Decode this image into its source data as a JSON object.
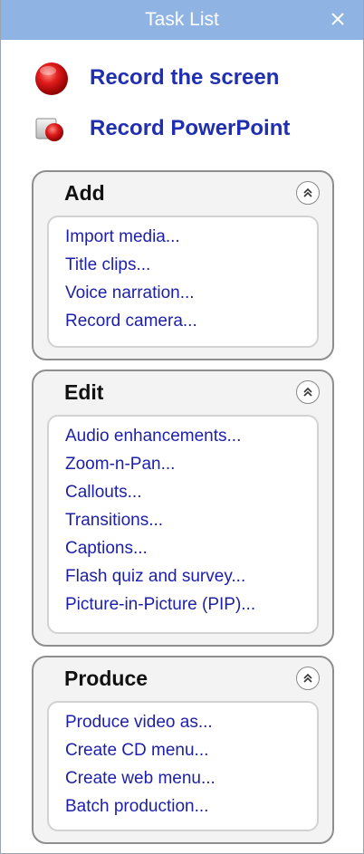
{
  "window": {
    "title": "Task List",
    "close_glyph": "✕"
  },
  "record": [
    {
      "label": "Record the screen",
      "icon": "record-screen-icon"
    },
    {
      "label": "Record PowerPoint",
      "icon": "record-powerpoint-icon"
    }
  ],
  "groups": {
    "add": {
      "title": "Add",
      "items": [
        "Import media...",
        "Title clips...",
        "Voice narration...",
        "Record camera..."
      ]
    },
    "edit": {
      "title": "Edit",
      "items": [
        "Audio enhancements...",
        "Zoom-n-Pan...",
        "Callouts...",
        "Transitions...",
        "Captions...",
        "Flash quiz and survey...",
        "Picture-in-Picture (PIP)..."
      ]
    },
    "produce": {
      "title": "Produce",
      "items": [
        "Produce video as...",
        "Create CD menu...",
        "Create web menu...",
        "Batch production..."
      ]
    }
  },
  "colors": {
    "titlebar": "#8fb4e3",
    "link": "#1c1fa8",
    "record_label": "#1f2fb0",
    "record_red": "#d21414"
  }
}
